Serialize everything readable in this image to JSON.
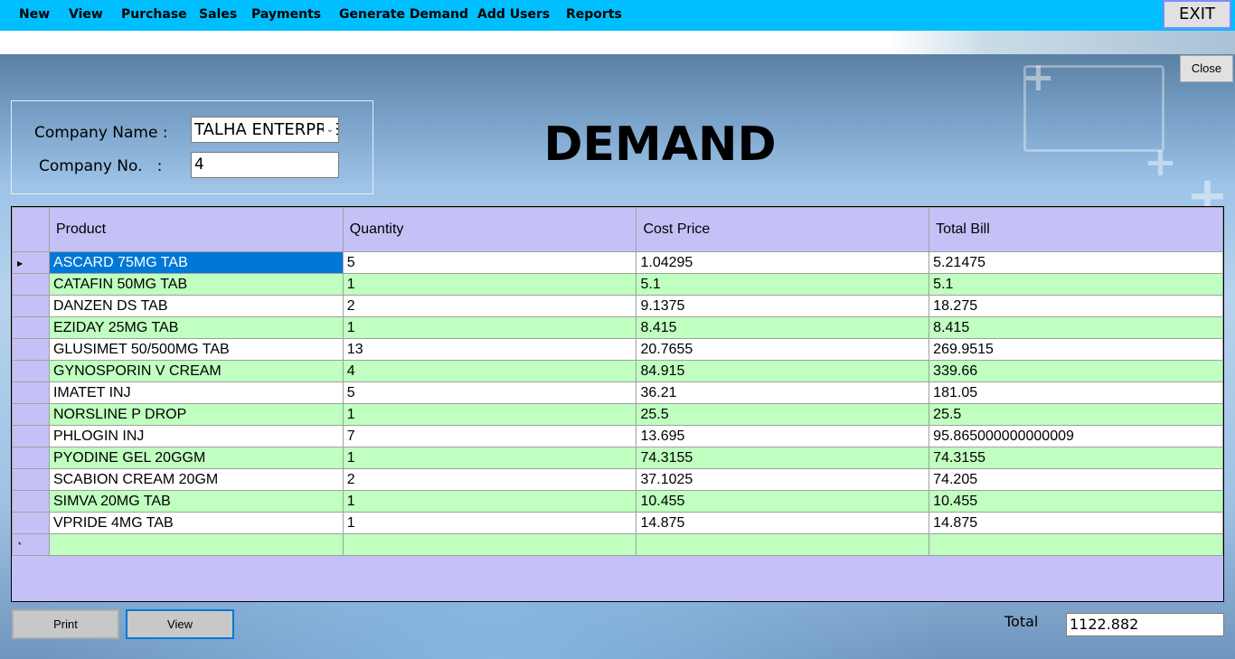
{
  "menu": {
    "items": [
      "New",
      "View",
      "Purchase",
      "Sales",
      "Payments",
      "Generate Demand",
      "Add Users",
      "Reports"
    ],
    "exit_label": "EXIT"
  },
  "form": {
    "close_label": "Close",
    "title": "DEMAND",
    "company_name_label": "Company Name :",
    "company_name_value": "TALHA ENTERPRISES",
    "company_no_label": "Company No.   :",
    "company_no_value": "4"
  },
  "grid": {
    "columns": [
      "Product",
      "Quantity",
      "Cost Price",
      "Total Bill"
    ],
    "rows": [
      [
        "ASCARD 75MG TAB",
        "5",
        "1.04295",
        "5.21475"
      ],
      [
        "CATAFIN 50MG TAB",
        "1",
        "5.1",
        "5.1"
      ],
      [
        "DANZEN DS TAB",
        "2",
        "9.1375",
        "18.275"
      ],
      [
        "EZIDAY 25MG TAB",
        "1",
        "8.415",
        "8.415"
      ],
      [
        "GLUSIMET 50/500MG TAB",
        "13",
        "20.7655",
        "269.9515"
      ],
      [
        "GYNOSPORIN V CREAM",
        "4",
        "84.915",
        "339.66"
      ],
      [
        "IMATET INJ",
        "5",
        "36.21",
        "181.05"
      ],
      [
        "NORSLINE P DROP",
        "1",
        "25.5",
        "25.5"
      ],
      [
        "PHLOGIN INJ",
        "7",
        "13.695",
        "95.865000000000009"
      ],
      [
        "PYODINE GEL 20GGM",
        "1",
        "74.3155",
        "74.3155"
      ],
      [
        "SCABION CREAM 20GM",
        "2",
        "37.1025",
        "74.205"
      ],
      [
        "SIMVA  20MG TAB",
        "1",
        "10.455",
        "10.455"
      ],
      [
        "VPRIDE 4MG TAB",
        "1",
        "14.875",
        "14.875"
      ]
    ],
    "selected_row": 0
  },
  "footer": {
    "print_label": "Print",
    "view_label": "View",
    "total_label": "Total",
    "total_value": "1122.882"
  }
}
